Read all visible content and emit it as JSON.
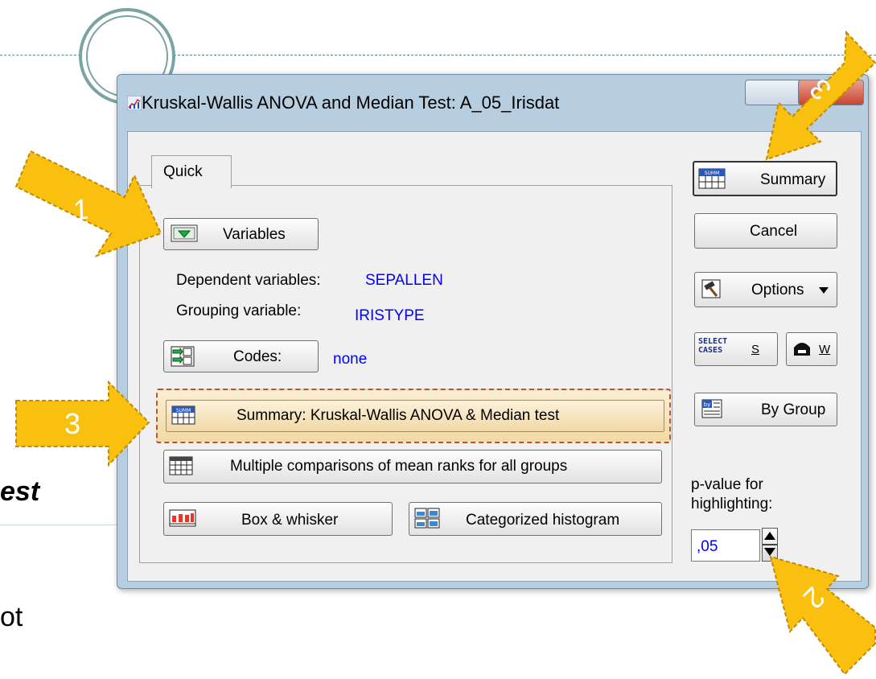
{
  "window": {
    "title": "Kruskal-Wallis ANOVA and Median Test: A_05_Irisdat"
  },
  "tab": {
    "quick_label": "Quick"
  },
  "buttons": {
    "variables": "Variables",
    "codes": "Codes:",
    "summary_kw": "Summary:  Kruskal-Wallis ANOVA  & Median test",
    "multiple_comparisons": "Multiple comparisons of mean ranks for all groups",
    "box_whisker": "Box & whisker",
    "categorized_histogram": "Categorized histogram",
    "summary": "Summary",
    "cancel": "Cancel",
    "options": "Options",
    "select_cases_hotkey": "S",
    "weight_hotkey": "W",
    "by_group": "By Group"
  },
  "fields": {
    "dependent_label": "Dependent variables:",
    "dependent_value": "SEPALLEN",
    "grouping_label": "Grouping variable:",
    "grouping_value": "IRISTYPE",
    "codes_value": "none",
    "pvalue_label_line1": "p-value for",
    "pvalue_label_line2": "highlighting:",
    "pvalue_value": ",05"
  },
  "icons": {
    "select_cases_line1": "SELECT",
    "select_cases_line2": "CASES",
    "summary_icon_text": "SUMM",
    "by_group_icon_text": "by"
  },
  "callouts": {
    "one": "1",
    "two": "2",
    "three_left": "3",
    "three_top": "3"
  },
  "slide_fragments": {
    "right_italic": "est",
    "bottom": "ot"
  },
  "colors": {
    "accent_blue": "#0000ff",
    "callout_fill": "#f9c010",
    "highlight_border": "#b0543c",
    "dialog_frame": "#b7cde0"
  }
}
